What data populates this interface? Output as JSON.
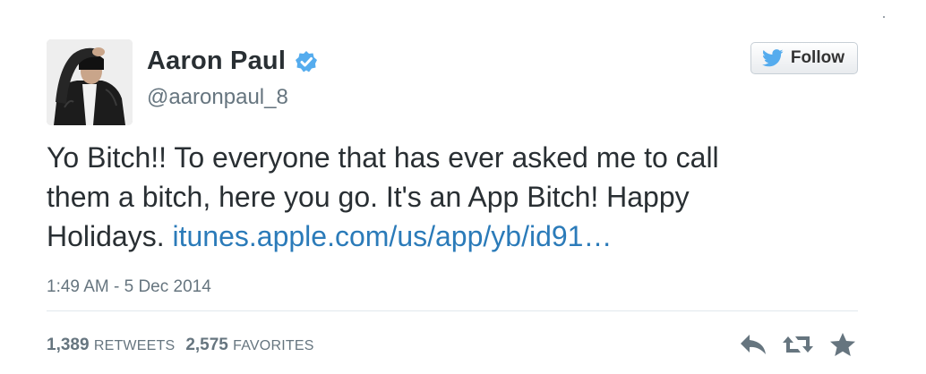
{
  "author": {
    "fullname": "Aaron Paul",
    "username": "@aaronpaul_8",
    "verified": true,
    "avatar_icon": "person-avatar"
  },
  "follow_button": {
    "label": "Follow",
    "icon": "twitter-bird-icon"
  },
  "tweet": {
    "text_part1": "Yo Bitch!! To everyone that has ever asked me to call",
    "text_part2": "them a bitch, here you go. It's an App Bitch! Happy",
    "text_part3": "Holidays.",
    "link_text": "itunes.apple.com/us/app/yb/id91…",
    "timestamp": "1:49 AM - 5 Dec 2014"
  },
  "stats": {
    "retweets_count": "1,389",
    "retweets_label": "RETWEETS",
    "favorites_count": "2,575",
    "favorites_label": "FAVORITES"
  },
  "actions": {
    "reply_icon": "reply-icon",
    "retweet_icon": "retweet-icon",
    "favorite_icon": "star-icon"
  },
  "colors": {
    "link": "#2b7bb9",
    "text": "#292f33",
    "muted": "#66757f",
    "verified": "#55acee",
    "bird": "#55acee",
    "action": "#66757f"
  }
}
